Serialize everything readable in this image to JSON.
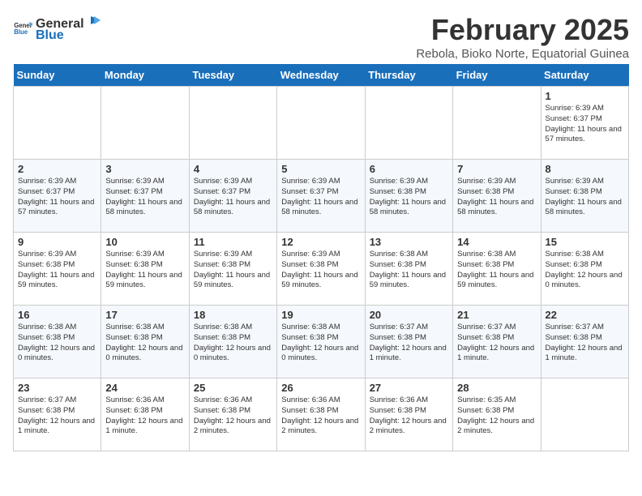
{
  "header": {
    "logo_line1": "General",
    "logo_line2": "Blue",
    "month_title": "February 2025",
    "location": "Rebola, Bioko Norte, Equatorial Guinea"
  },
  "days_of_week": [
    "Sunday",
    "Monday",
    "Tuesday",
    "Wednesday",
    "Thursday",
    "Friday",
    "Saturday"
  ],
  "weeks": [
    [
      {
        "day": "",
        "text": ""
      },
      {
        "day": "",
        "text": ""
      },
      {
        "day": "",
        "text": ""
      },
      {
        "day": "",
        "text": ""
      },
      {
        "day": "",
        "text": ""
      },
      {
        "day": "",
        "text": ""
      },
      {
        "day": "1",
        "text": "Sunrise: 6:39 AM\nSunset: 6:37 PM\nDaylight: 11 hours and 57 minutes."
      }
    ],
    [
      {
        "day": "2",
        "text": "Sunrise: 6:39 AM\nSunset: 6:37 PM\nDaylight: 11 hours and 57 minutes."
      },
      {
        "day": "3",
        "text": "Sunrise: 6:39 AM\nSunset: 6:37 PM\nDaylight: 11 hours and 58 minutes."
      },
      {
        "day": "4",
        "text": "Sunrise: 6:39 AM\nSunset: 6:37 PM\nDaylight: 11 hours and 58 minutes."
      },
      {
        "day": "5",
        "text": "Sunrise: 6:39 AM\nSunset: 6:37 PM\nDaylight: 11 hours and 58 minutes."
      },
      {
        "day": "6",
        "text": "Sunrise: 6:39 AM\nSunset: 6:38 PM\nDaylight: 11 hours and 58 minutes."
      },
      {
        "day": "7",
        "text": "Sunrise: 6:39 AM\nSunset: 6:38 PM\nDaylight: 11 hours and 58 minutes."
      },
      {
        "day": "8",
        "text": "Sunrise: 6:39 AM\nSunset: 6:38 PM\nDaylight: 11 hours and 58 minutes."
      }
    ],
    [
      {
        "day": "9",
        "text": "Sunrise: 6:39 AM\nSunset: 6:38 PM\nDaylight: 11 hours and 59 minutes."
      },
      {
        "day": "10",
        "text": "Sunrise: 6:39 AM\nSunset: 6:38 PM\nDaylight: 11 hours and 59 minutes."
      },
      {
        "day": "11",
        "text": "Sunrise: 6:39 AM\nSunset: 6:38 PM\nDaylight: 11 hours and 59 minutes."
      },
      {
        "day": "12",
        "text": "Sunrise: 6:39 AM\nSunset: 6:38 PM\nDaylight: 11 hours and 59 minutes."
      },
      {
        "day": "13",
        "text": "Sunrise: 6:38 AM\nSunset: 6:38 PM\nDaylight: 11 hours and 59 minutes."
      },
      {
        "day": "14",
        "text": "Sunrise: 6:38 AM\nSunset: 6:38 PM\nDaylight: 11 hours and 59 minutes."
      },
      {
        "day": "15",
        "text": "Sunrise: 6:38 AM\nSunset: 6:38 PM\nDaylight: 12 hours and 0 minutes."
      }
    ],
    [
      {
        "day": "16",
        "text": "Sunrise: 6:38 AM\nSunset: 6:38 PM\nDaylight: 12 hours and 0 minutes."
      },
      {
        "day": "17",
        "text": "Sunrise: 6:38 AM\nSunset: 6:38 PM\nDaylight: 12 hours and 0 minutes."
      },
      {
        "day": "18",
        "text": "Sunrise: 6:38 AM\nSunset: 6:38 PM\nDaylight: 12 hours and 0 minutes."
      },
      {
        "day": "19",
        "text": "Sunrise: 6:38 AM\nSunset: 6:38 PM\nDaylight: 12 hours and 0 minutes."
      },
      {
        "day": "20",
        "text": "Sunrise: 6:37 AM\nSunset: 6:38 PM\nDaylight: 12 hours and 1 minute."
      },
      {
        "day": "21",
        "text": "Sunrise: 6:37 AM\nSunset: 6:38 PM\nDaylight: 12 hours and 1 minute."
      },
      {
        "day": "22",
        "text": "Sunrise: 6:37 AM\nSunset: 6:38 PM\nDaylight: 12 hours and 1 minute."
      }
    ],
    [
      {
        "day": "23",
        "text": "Sunrise: 6:37 AM\nSunset: 6:38 PM\nDaylight: 12 hours and 1 minute."
      },
      {
        "day": "24",
        "text": "Sunrise: 6:36 AM\nSunset: 6:38 PM\nDaylight: 12 hours and 1 minute."
      },
      {
        "day": "25",
        "text": "Sunrise: 6:36 AM\nSunset: 6:38 PM\nDaylight: 12 hours and 2 minutes."
      },
      {
        "day": "26",
        "text": "Sunrise: 6:36 AM\nSunset: 6:38 PM\nDaylight: 12 hours and 2 minutes."
      },
      {
        "day": "27",
        "text": "Sunrise: 6:36 AM\nSunset: 6:38 PM\nDaylight: 12 hours and 2 minutes."
      },
      {
        "day": "28",
        "text": "Sunrise: 6:35 AM\nSunset: 6:38 PM\nDaylight: 12 hours and 2 minutes."
      },
      {
        "day": "",
        "text": ""
      }
    ]
  ]
}
